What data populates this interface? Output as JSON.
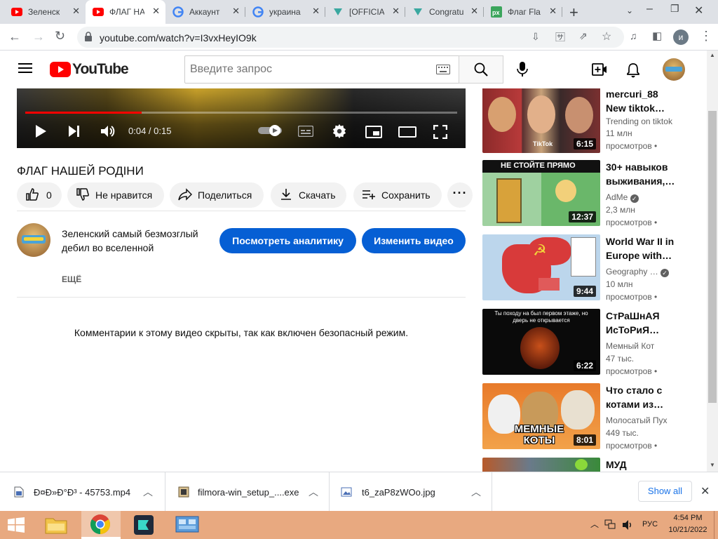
{
  "browser": {
    "tabs": [
      {
        "label": "Зеленск",
        "icon": "youtube-icon"
      },
      {
        "label": "ФЛАГ НА",
        "icon": "youtube-icon",
        "active": true
      },
      {
        "label": "Аккаунт",
        "icon": "google-icon"
      },
      {
        "label": "украина",
        "icon": "google-icon"
      },
      {
        "label": "[OFFICIA",
        "icon": "site-icon"
      },
      {
        "label": "Congratu",
        "icon": "site-icon"
      },
      {
        "label": "Флаг Fla",
        "icon": "px-icon"
      }
    ],
    "url": "youtube.com/watch?v=I3vxHeyIO9k"
  },
  "youtube": {
    "logo_text": "YouTube",
    "search_placeholder": "Введите запрос",
    "video": {
      "current_time": "0:04",
      "duration": "0:15",
      "time_display": "0:04 / 0:15",
      "progress_fraction": 0.27,
      "title": "ФЛАГ НАШЕЙ РОДІНИ"
    },
    "actions": {
      "like_count": "0",
      "dislike_label": "Не нравится",
      "share_label": "Поделиться",
      "download_label": "Скачать",
      "save_label": "Сохранить"
    },
    "channel": {
      "name": "Зеленский самый безмозглый дебил во вселенной",
      "analytics_button": "Посмотреть аналитику",
      "edit_button": "Изменить видео",
      "more_label": "ЕЩЁ"
    },
    "comments_disabled_text": "Комментарии к этому видео скрыты, так как включен безопасный режим.",
    "sidebar": [
      {
        "title": "mercuri_88 New tiktok…",
        "title_l1": "mercuri_88",
        "title_l2": "New tiktok…",
        "channel": "Trending on tiktok",
        "views_l1": "11 млн",
        "views_l2": "просмотров •",
        "duration": "6:15",
        "thumb_text": "TikTok",
        "verified": false
      },
      {
        "title": "30+ навыков выживания,…",
        "title_l1": "30+ навыков",
        "title_l2": "выживания,…",
        "channel": "AdMe",
        "views_l1": "2,3 млн",
        "views_l2": "просмотров •",
        "duration": "12:37",
        "thumb_text": "НЕ СТОЙТЕ ПРЯМО",
        "verified": true
      },
      {
        "title": "World War II in Europe with…",
        "title_l1": "World War II in",
        "title_l2": "Europe with…",
        "channel": "Geography …",
        "views_l1": "10 млн",
        "views_l2": "просмотров •",
        "duration": "9:44",
        "thumb_text": "",
        "verified": true
      },
      {
        "title": "СтРаШнАЯ ИсТоРиЯ…",
        "title_l1": "СтРаШнАЯ",
        "title_l2": "ИсТоРиЯ…",
        "channel": "Мемный Кот",
        "views_l1": "47 тыс.",
        "views_l2": "просмотров •",
        "duration": "6:22",
        "thumb_text": "Ты походу на был первом этаже, но дверь не открывается",
        "verified": false
      },
      {
        "title": "Что стало с котами из…",
        "title_l1": "Что стало с",
        "title_l2": "котами из…",
        "channel": "Молосатый Пух",
        "views_l1": "449 тыс.",
        "views_l2": "просмотров •",
        "duration": "8:01",
        "thumb_text": "МЕМНЫЕ КОТЫ",
        "verified": false
      },
      {
        "title": "МУД",
        "title_l1": "МУД",
        "title_l2": "",
        "channel": "",
        "views_l1": "",
        "views_l2": "",
        "duration": "",
        "thumb_text": "",
        "verified": false
      }
    ]
  },
  "downloads": {
    "items": [
      {
        "name": "Ð¤Ð»Ð°Ð³ - 45753.mp4",
        "icon": "video-file-icon"
      },
      {
        "name": "filmora-win_setup_....exe",
        "icon": "exe-file-icon"
      },
      {
        "name": "t6_zaP8zWOo.jpg",
        "icon": "image-file-icon"
      }
    ],
    "show_all": "Show all"
  },
  "taskbar": {
    "lang": "РУС",
    "time": "4:54 PM",
    "date": "10/21/2022"
  },
  "colors": {
    "youtube_red": "#ff0000",
    "button_blue": "#065fd4",
    "taskbar": "#e8a980"
  }
}
